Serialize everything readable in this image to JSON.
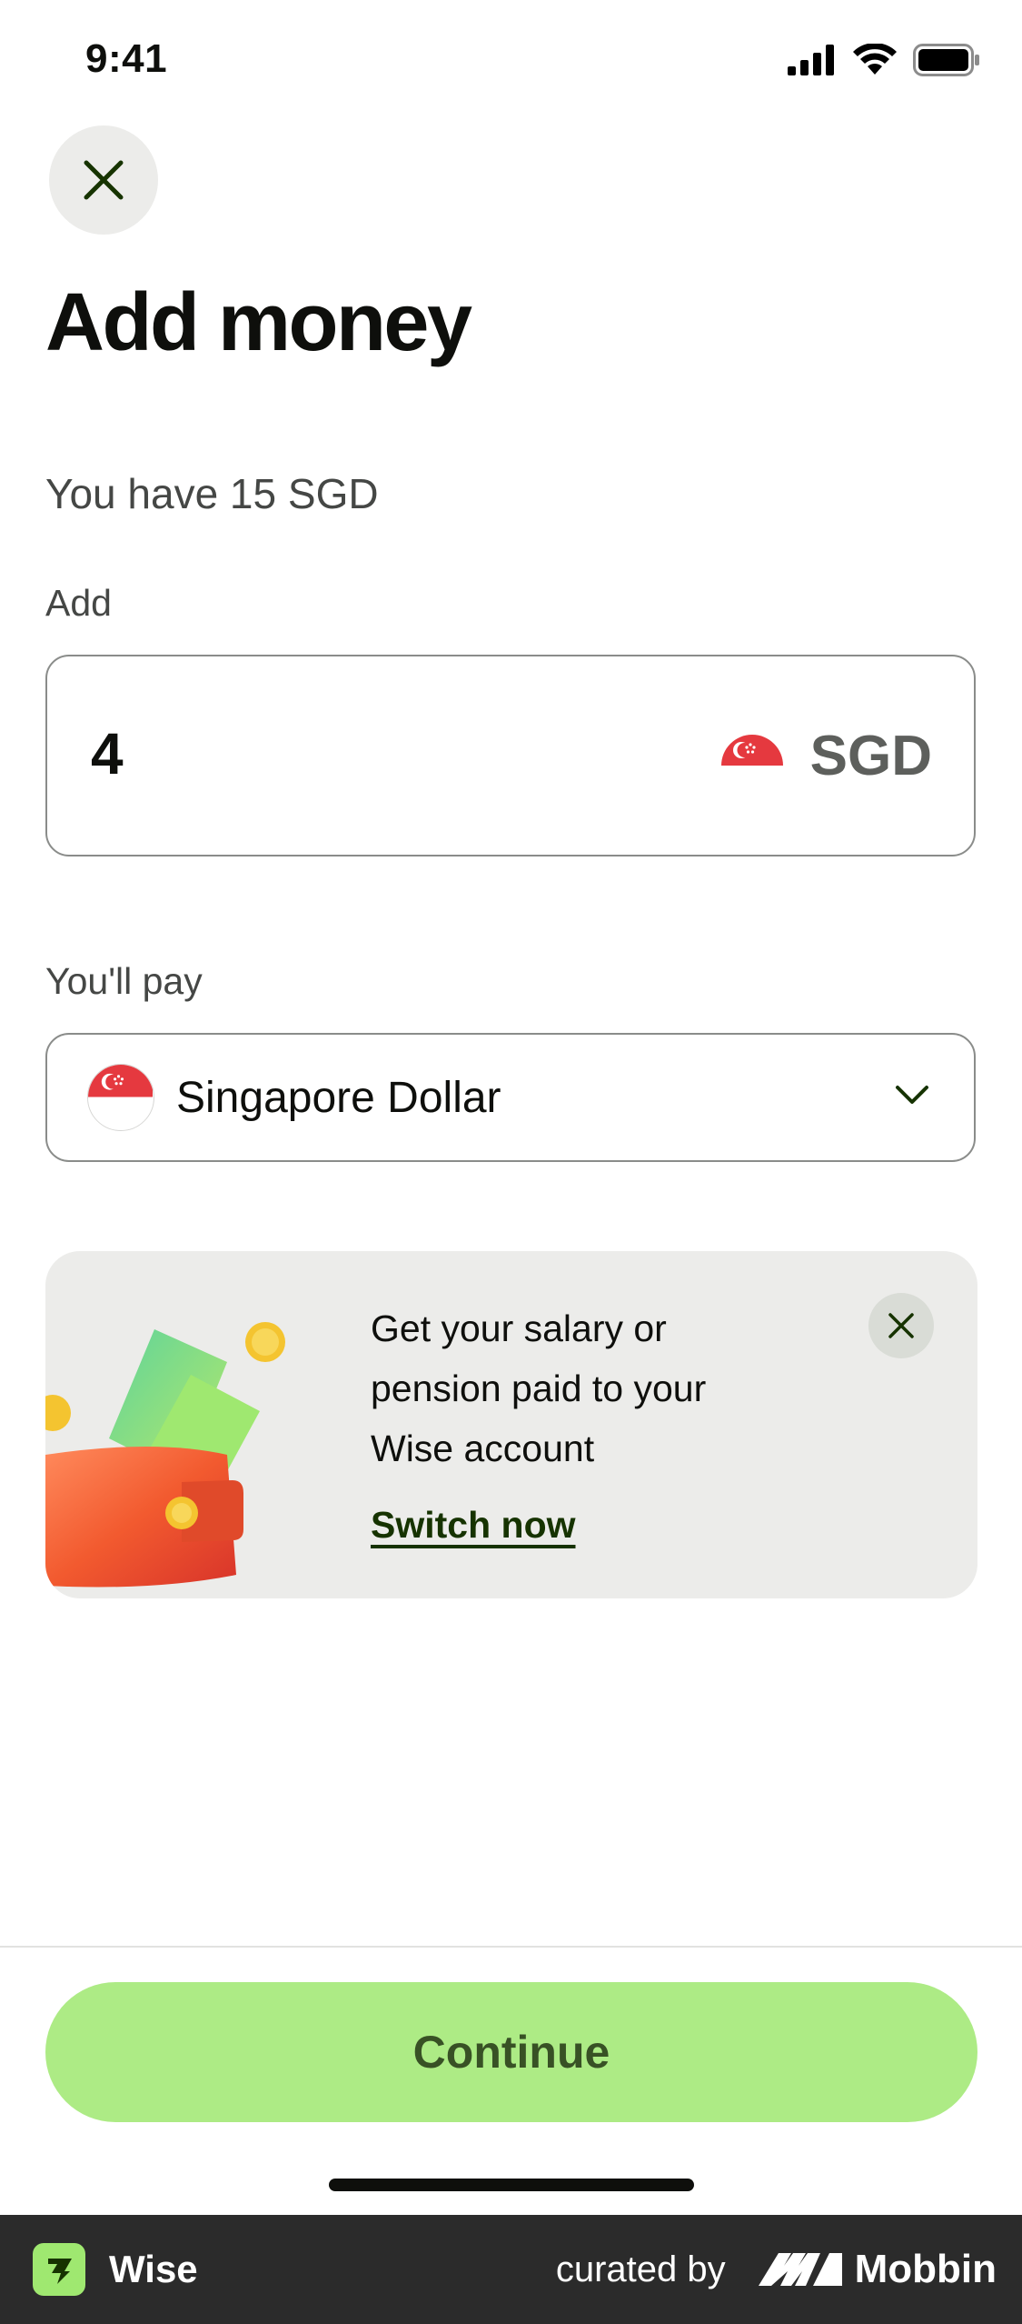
{
  "status_bar": {
    "time": "9:41"
  },
  "header": {
    "title": "Add money"
  },
  "balance": {
    "text": "You have 15 SGD"
  },
  "add_section": {
    "label": "Add",
    "amount": "4",
    "currency_code": "SGD"
  },
  "pay_section": {
    "label": "You'll pay",
    "selected": "Singapore Dollar"
  },
  "promo": {
    "line1": "Get your salary or",
    "line2": "pension paid to your",
    "line3": "Wise account",
    "link": "Switch now"
  },
  "actions": {
    "continue_label": "Continue"
  },
  "footer": {
    "app_name": "Wise",
    "curated_by": "curated by",
    "curator": "Mobbin"
  },
  "colors": {
    "accent": "#9fe870",
    "forest": "#163300",
    "flag_red": "#e5393f"
  }
}
